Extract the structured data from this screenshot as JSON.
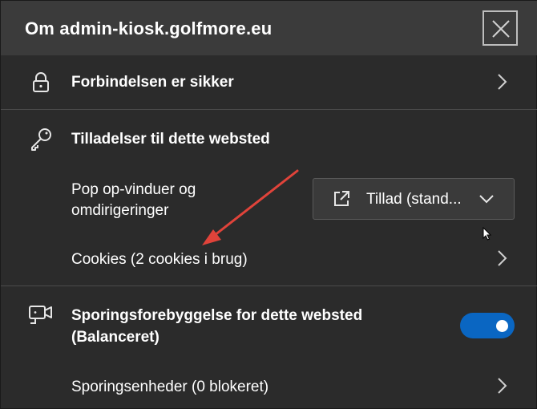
{
  "header": {
    "title": "Om admin-kiosk.golfmore.eu",
    "close_icon": "close-icon"
  },
  "connection": {
    "icon": "lock-icon",
    "label": "Forbindelsen er sikker"
  },
  "permissions": {
    "icon": "key-icon",
    "heading": "Tilladelser til dette websted",
    "popups_label_line1": "Pop op-vinduer og",
    "popups_label_line2": "omdirigeringer",
    "popups_dropdown_icon": "external-window-icon",
    "popups_dropdown_value": "Tillad (stand...",
    "cookies_label": "Cookies (2 cookies i brug)"
  },
  "tracking": {
    "icon": "camera-icon",
    "label_line1": "Sporingsforebyggelse for dette websted",
    "label_line2": "(Balanceret)",
    "toggle_on": true,
    "trackers_label": "Sporingsenheder (0 blokeret)"
  },
  "colors": {
    "background": "#2b2b2b",
    "header": "#3b3b3b",
    "toggle_on": "#0a66c2",
    "annotation_arrow": "#e0433a"
  }
}
